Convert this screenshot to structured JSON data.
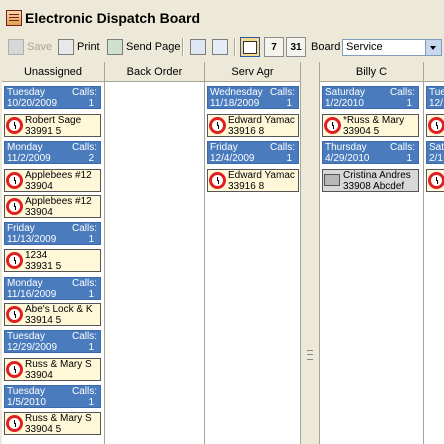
{
  "window": {
    "title": "Electronic Dispatch Board"
  },
  "toolbar": {
    "save_label": "Save",
    "print_label": "Print",
    "send_page_label": "Send Page",
    "view_day_label": "",
    "view_7_label": "7",
    "view_31_label": "31",
    "board_label": "Board",
    "board_value": "Service"
  },
  "columns": {
    "unassigned": "Unassigned",
    "back_order": "Back Order",
    "serv_agr": "Serv Agr",
    "billy_c": "Billy C"
  },
  "calls_label": "Calls:",
  "unassigned": [
    {
      "day": "Tuesday",
      "date": "10/20/2009",
      "count": "1"
    },
    {
      "name": "Robert Sage",
      "code": "33991  5"
    },
    {
      "day": "Monday",
      "date": "11/2/2009",
      "count": "2"
    },
    {
      "name": "Applebees #12",
      "code": "33904"
    },
    {
      "name": "Applebees #12",
      "code": "33904"
    },
    {
      "day": "Friday",
      "date": "11/13/2009",
      "count": "1"
    },
    {
      "name": "1234",
      "code": "33931  5"
    },
    {
      "day": "Monday",
      "date": "11/16/2009",
      "count": "1"
    },
    {
      "name": "Abe's Lock & K",
      "code": "33914  5"
    },
    {
      "day": "Tuesday",
      "date": "12/29/2009",
      "count": "1"
    },
    {
      "name": "Russ & Mary S",
      "code": "33904"
    },
    {
      "day": "Tuesday",
      "date": "1/5/2010",
      "count": "1"
    },
    {
      "name": "Russ & Mary S",
      "code": "33904  5"
    }
  ],
  "serv_agr": [
    {
      "day": "Wednesday",
      "date": "11/18/2009",
      "count": "1"
    },
    {
      "name": "Edward Yamac",
      "code": "33916  8"
    },
    {
      "day": "Friday",
      "date": "12/4/2009",
      "count": "1"
    },
    {
      "name": "Edward Yamac",
      "code": "33916  8"
    }
  ],
  "billy_c": [
    {
      "day": "Saturday",
      "date": "1/2/2010",
      "count": "1"
    },
    {
      "name": "*Russ & Mary",
      "code": "33904  5"
    },
    {
      "day": "Thursday",
      "date": "4/29/2010",
      "count": "1"
    },
    {
      "name": "Cristina Andres",
      "code": "33908  Abcdef"
    }
  ],
  "next_col": [
    {
      "day": "Tue",
      "date": "12/"
    },
    {
      "day": "Sat",
      "date": "2/1"
    }
  ]
}
